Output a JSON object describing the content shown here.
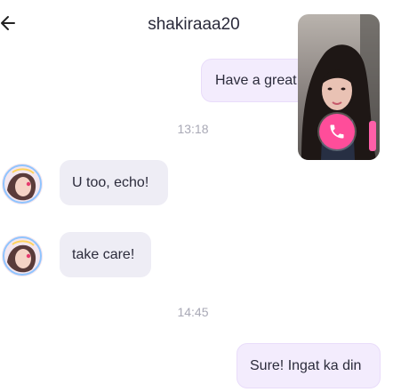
{
  "header": {
    "contact_name": "shakiraaa20",
    "back_icon": "arrow-left-icon"
  },
  "messages": [
    {
      "direction": "outgoing",
      "text": "Have a great"
    },
    {
      "direction": "timestamp",
      "text": "13:18"
    },
    {
      "direction": "incoming",
      "text": "U too, echo!"
    },
    {
      "direction": "incoming",
      "text": "take care!"
    },
    {
      "direction": "timestamp",
      "text": "14:45"
    },
    {
      "direction": "outgoing",
      "text": "Sure! Ingat ka din"
    }
  ],
  "video_call": {
    "call_icon": "phone-icon",
    "accent_color": "#ff4d9a"
  },
  "colors": {
    "outgoing_bubble": "#f3ecfd",
    "incoming_bubble": "#eeedf5",
    "timestamp": "#a9a9b6"
  }
}
